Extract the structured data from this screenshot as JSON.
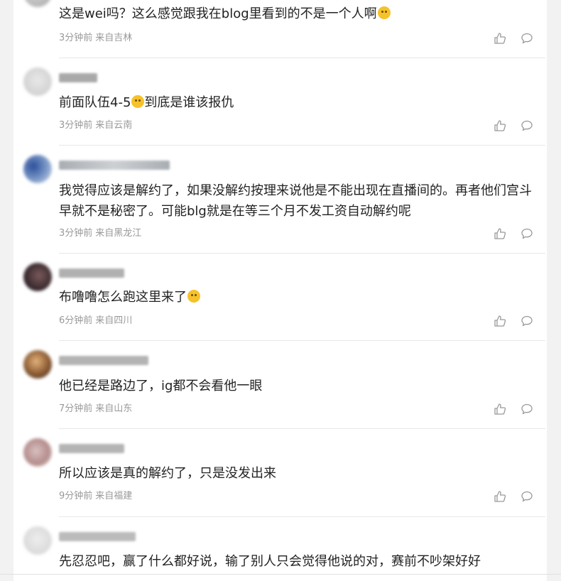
{
  "comments": [
    {
      "text_before": "这是wei吗？这么感觉跟我在blog里看到的不是一个人啊",
      "text_after": "",
      "emoji": "laughing-sweat-emoji",
      "time": "3分钟前",
      "location": "来自吉林"
    },
    {
      "text_before": "前面队伍4-5",
      "text_after": "到底是谁该报仇",
      "emoji": "thinking-emoji",
      "time": "3分钟前",
      "location": "来自云南"
    },
    {
      "text_before": "我觉得应该是解约了，如果没解约按理来说他是不能出现在直播间的。再者他们宫斗早就不是秘密了。可能blg就是在等三个月不发工资自动解约呢",
      "text_after": "",
      "emoji": "",
      "time": "3分钟前",
      "location": "来自黑龙江"
    },
    {
      "text_before": "布噜噜怎么跑这里来了",
      "text_after": "",
      "emoji": "tears-of-joy-emoji",
      "time": "6分钟前",
      "location": "来自四川"
    },
    {
      "text_before": "他已经是路边了，ig都不会看他一眼",
      "text_after": "",
      "emoji": "",
      "time": "7分钟前",
      "location": "来自山东"
    },
    {
      "text_before": "所以应该是真的解约了，只是没发出来",
      "text_after": "",
      "emoji": "",
      "time": "9分钟前",
      "location": "来自福建"
    },
    {
      "text_before": "先忍忍吧，赢了什么都好说，输了别人只会觉得他说的对，赛前不吵架好好",
      "text_after": "",
      "emoji": "",
      "time": "",
      "location": ""
    }
  ],
  "colors": {
    "text": "#222222",
    "meta": "#999999",
    "divider": "#e8e8e8",
    "background": "#f2f2f2",
    "panel": "#ffffff"
  },
  "icons": {
    "like": "thumbs-up-icon",
    "reply": "comment-bubble-icon"
  }
}
